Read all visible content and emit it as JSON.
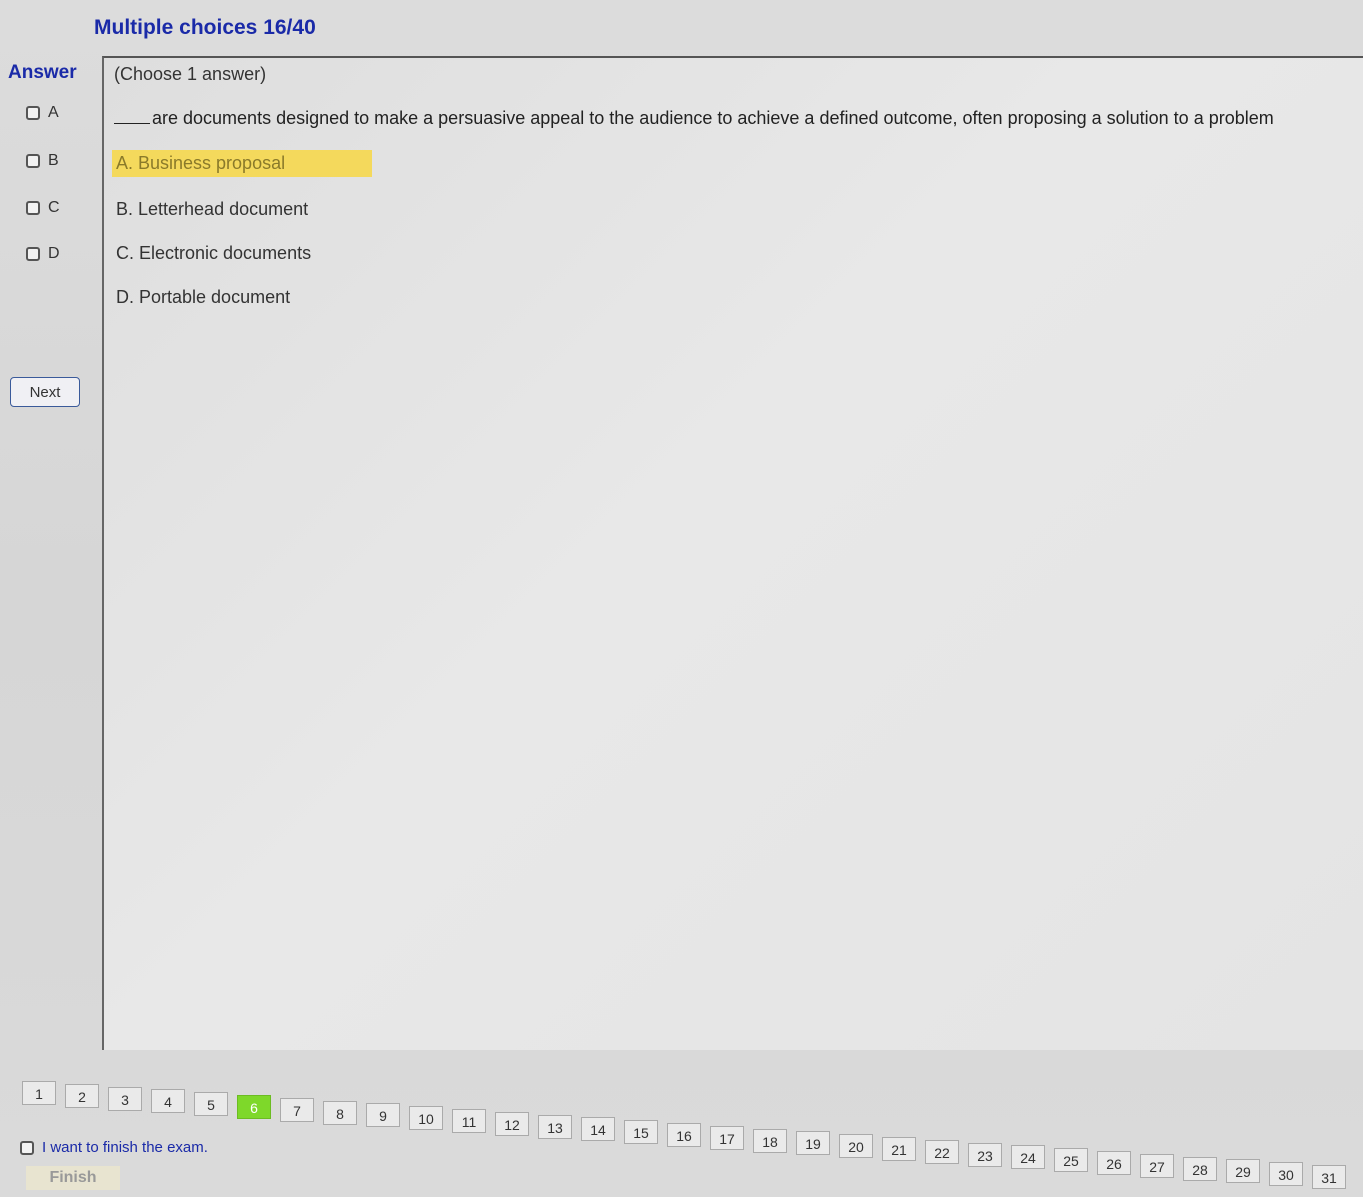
{
  "header": {
    "title": "Multiple choices 16/40"
  },
  "sidebar": {
    "answer_label": "Answer",
    "options": [
      {
        "label": "A"
      },
      {
        "label": "B"
      },
      {
        "label": "C"
      },
      {
        "label": "D"
      }
    ],
    "next_label": "Next"
  },
  "question": {
    "instruction": "(Choose 1 answer)",
    "text": "are documents designed to make a persuasive appeal to the audience to achieve a defined outcome, often proposing a solution to a problem",
    "choices": [
      {
        "text": "A. Business proposal",
        "highlighted": true
      },
      {
        "text": "B. Letterhead document",
        "highlighted": false
      },
      {
        "text": "C. Electronic documents",
        "highlighted": false
      },
      {
        "text": "D. Portable document",
        "highlighted": false
      }
    ]
  },
  "pagination": {
    "current": 6,
    "pages": [
      "1",
      "2",
      "3",
      "4",
      "5",
      "6",
      "7",
      "8",
      "9",
      "10",
      "11",
      "12",
      "13",
      "14",
      "15",
      "16",
      "17",
      "18",
      "19",
      "20",
      "21",
      "22",
      "23",
      "24",
      "25",
      "26",
      "27",
      "28",
      "29",
      "30",
      "31"
    ],
    "current_color": "#7ed82a"
  },
  "footer": {
    "finish_checkbox_label": "I want to finish the exam.",
    "finish_button_label": "Finish"
  },
  "colors": {
    "title": "#1a2aa8",
    "highlight": "#f4d95c"
  }
}
